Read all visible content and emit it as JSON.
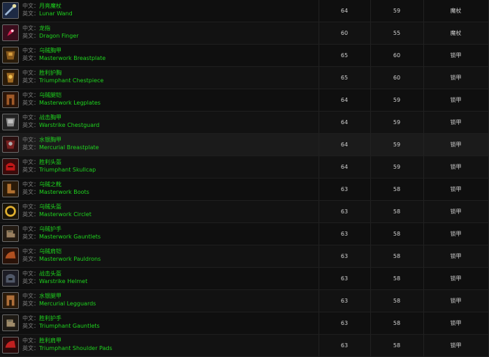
{
  "labels": {
    "cn_prefix": "中文：",
    "en_prefix": "英文："
  },
  "rows": [
    {
      "icon": "wand-icon",
      "cn": "月亮魔杖",
      "en": "Lunar Wand",
      "item_level": "64",
      "req_level": "59",
      "type": "魔杖"
    },
    {
      "icon": "ring-icon",
      "cn": "龙指",
      "en": "Dragon Finger",
      "item_level": "60",
      "req_level": "55",
      "type": "魔杖"
    },
    {
      "icon": "breastplate-icon",
      "cn": "乌贼胸甲",
      "en": "Masterwork Breastplate",
      "item_level": "65",
      "req_level": "60",
      "type": "锁甲"
    },
    {
      "icon": "chestpiece-icon",
      "cn": "胜利护胸",
      "en": "Triumphant Chestpiece",
      "item_level": "65",
      "req_level": "60",
      "type": "锁甲"
    },
    {
      "icon": "legplates-icon",
      "cn": "乌贼腿铠",
      "en": "Masterwork Legplates",
      "item_level": "64",
      "req_level": "59",
      "type": "锁甲"
    },
    {
      "icon": "chestguard-icon",
      "cn": "战击胸甲",
      "en": "Warstrike Chestguard",
      "item_level": "64",
      "req_level": "59",
      "type": "锁甲"
    },
    {
      "icon": "mercurial-breastplate-icon",
      "cn": "水银胸甲",
      "en": "Mercurial Breastplate",
      "item_level": "64",
      "req_level": "59",
      "type": "锁甲"
    },
    {
      "icon": "skullcap-icon",
      "cn": "胜利头盔",
      "en": "Triumphant Skullcap",
      "item_level": "64",
      "req_level": "59",
      "type": "锁甲"
    },
    {
      "icon": "boots-icon",
      "cn": "乌贼之靴",
      "en": "Masterwork Boots",
      "item_level": "63",
      "req_level": "58",
      "type": "锁甲"
    },
    {
      "icon": "circlet-icon",
      "cn": "乌贼头盔",
      "en": "Masterwork Circlet",
      "item_level": "63",
      "req_level": "58",
      "type": "锁甲"
    },
    {
      "icon": "gauntlets-icon",
      "cn": "乌贼护手",
      "en": "Masterwork Gauntlets",
      "item_level": "63",
      "req_level": "58",
      "type": "锁甲"
    },
    {
      "icon": "pauldrons-icon",
      "cn": "乌贼肩铠",
      "en": "Masterwork Pauldrons",
      "item_level": "63",
      "req_level": "58",
      "type": "锁甲"
    },
    {
      "icon": "helmet-icon",
      "cn": "战击头盔",
      "en": "Warstrike Helmet",
      "item_level": "63",
      "req_level": "58",
      "type": "锁甲"
    },
    {
      "icon": "legguards-icon",
      "cn": "水银腿甲",
      "en": "Mercurial Legguards",
      "item_level": "63",
      "req_level": "58",
      "type": "锁甲"
    },
    {
      "icon": "triumphant-gauntlets-icon",
      "cn": "胜利护手",
      "en": "Triumphant Gauntlets",
      "item_level": "63",
      "req_level": "58",
      "type": "锁甲"
    },
    {
      "icon": "shoulder-pads-icon",
      "cn": "胜利肩甲",
      "en": "Triumphant Shoulder Pads",
      "item_level": "63",
      "req_level": "58",
      "type": "锁甲"
    }
  ],
  "colors": {
    "name_green": "#1fd51f",
    "label_gray": "#7d7d7d",
    "background": "#0b0b0b"
  }
}
